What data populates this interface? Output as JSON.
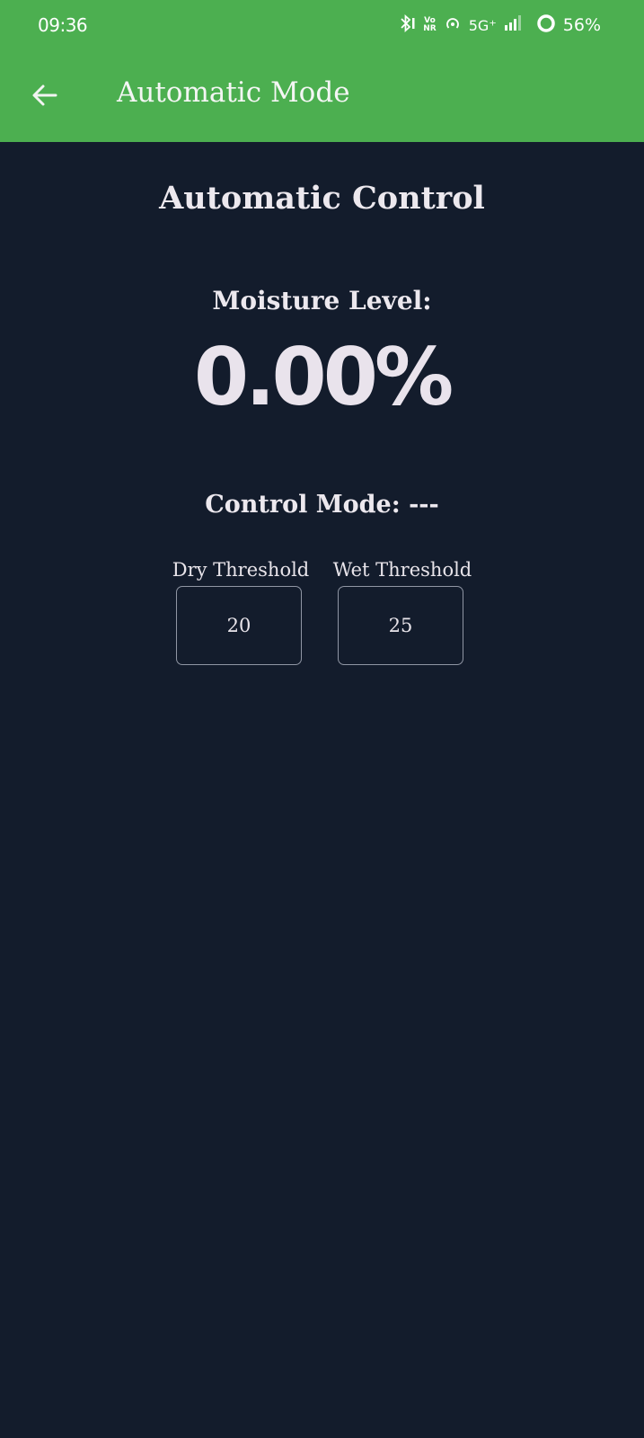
{
  "status_bar": {
    "time": "09:36",
    "network": "5G⁺",
    "volte_top": "Vo",
    "volte_bottom": "NR",
    "battery": "56%",
    "icons": [
      "bluetooth-icon",
      "volte-icon",
      "hotspot-icon",
      "signal-icon",
      "battery-icon"
    ]
  },
  "app_bar": {
    "title": "Automatic Mode",
    "back_icon": "arrow-left-icon",
    "color": "#4caf50"
  },
  "main": {
    "heading": "Automatic Control",
    "moisture_label": "Moisture Level:",
    "moisture_value": "0.00%",
    "control_mode": "Control Mode: ---"
  },
  "thresholds": {
    "dry": {
      "label": "Dry Threshold",
      "value": "20"
    },
    "wet": {
      "label": "Wet Threshold",
      "value": "25"
    }
  },
  "colors": {
    "background": "#131c2c",
    "accent": "#4caf50",
    "text": "#e8e4ea"
  }
}
